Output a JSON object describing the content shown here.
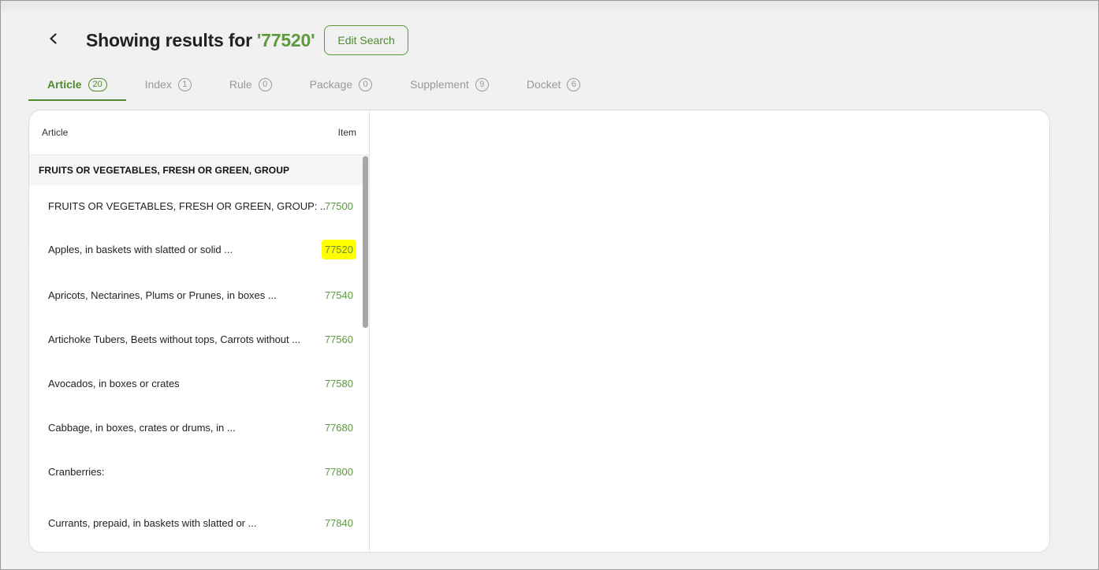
{
  "header": {
    "title_prefix": "Showing results for",
    "query": "'77520'",
    "edit_search_label": "Edit Search"
  },
  "icons": {
    "back": "chevron-left-icon"
  },
  "tabs": [
    {
      "label": "Article",
      "count": "20"
    },
    {
      "label": "Index",
      "count": "1"
    },
    {
      "label": "Rule",
      "count": "0"
    },
    {
      "label": "Package",
      "count": "0"
    },
    {
      "label": "Supplement",
      "count": "9"
    },
    {
      "label": "Docket",
      "count": "6"
    }
  ],
  "list": {
    "column_article": "Article",
    "column_item": "Item",
    "group": "FRUITS OR VEGETABLES, FRESH OR GREEN, GROUP",
    "rows": [
      {
        "label": "FRUITS OR VEGETABLES, FRESH OR GREEN, GROUP: ...",
        "item": "77500"
      },
      {
        "label": "Apples, in baskets with slatted or solid ...",
        "item": "77520"
      },
      {
        "label": "Apricots, Nectarines, Plums or Prunes, in boxes ...",
        "item": "77540"
      },
      {
        "label": "Artichoke Tubers, Beets without tops, Carrots without ...",
        "item": "77560"
      },
      {
        "label": "Avocados, in boxes or crates",
        "item": "77580"
      },
      {
        "label": "Cabbage, in boxes, crates or drums, in ...",
        "item": "77680"
      },
      {
        "label": "Cranberries:",
        "item": "77800"
      },
      {
        "label": "Currants, prepaid, in baskets with slatted or ...",
        "item": "77840"
      }
    ]
  },
  "colors": {
    "accent": "#5c9a3c",
    "highlight": "#ffff00"
  }
}
